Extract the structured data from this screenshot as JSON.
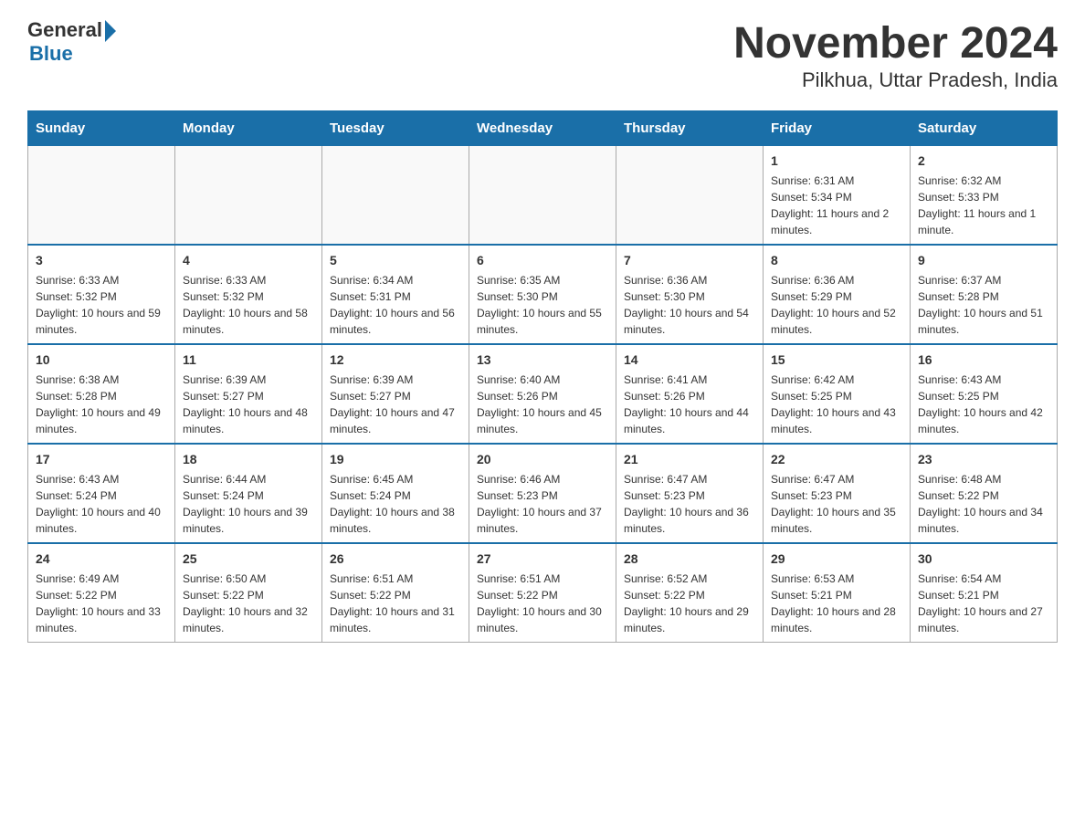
{
  "header": {
    "logo_general": "General",
    "logo_blue": "Blue",
    "title": "November 2024",
    "subtitle": "Pilkhua, Uttar Pradesh, India"
  },
  "days_of_week": [
    "Sunday",
    "Monday",
    "Tuesday",
    "Wednesday",
    "Thursday",
    "Friday",
    "Saturday"
  ],
  "weeks": [
    [
      {
        "day": "",
        "info": ""
      },
      {
        "day": "",
        "info": ""
      },
      {
        "day": "",
        "info": ""
      },
      {
        "day": "",
        "info": ""
      },
      {
        "day": "",
        "info": ""
      },
      {
        "day": "1",
        "info": "Sunrise: 6:31 AM\nSunset: 5:34 PM\nDaylight: 11 hours and 2 minutes."
      },
      {
        "day": "2",
        "info": "Sunrise: 6:32 AM\nSunset: 5:33 PM\nDaylight: 11 hours and 1 minute."
      }
    ],
    [
      {
        "day": "3",
        "info": "Sunrise: 6:33 AM\nSunset: 5:32 PM\nDaylight: 10 hours and 59 minutes."
      },
      {
        "day": "4",
        "info": "Sunrise: 6:33 AM\nSunset: 5:32 PM\nDaylight: 10 hours and 58 minutes."
      },
      {
        "day": "5",
        "info": "Sunrise: 6:34 AM\nSunset: 5:31 PM\nDaylight: 10 hours and 56 minutes."
      },
      {
        "day": "6",
        "info": "Sunrise: 6:35 AM\nSunset: 5:30 PM\nDaylight: 10 hours and 55 minutes."
      },
      {
        "day": "7",
        "info": "Sunrise: 6:36 AM\nSunset: 5:30 PM\nDaylight: 10 hours and 54 minutes."
      },
      {
        "day": "8",
        "info": "Sunrise: 6:36 AM\nSunset: 5:29 PM\nDaylight: 10 hours and 52 minutes."
      },
      {
        "day": "9",
        "info": "Sunrise: 6:37 AM\nSunset: 5:28 PM\nDaylight: 10 hours and 51 minutes."
      }
    ],
    [
      {
        "day": "10",
        "info": "Sunrise: 6:38 AM\nSunset: 5:28 PM\nDaylight: 10 hours and 49 minutes."
      },
      {
        "day": "11",
        "info": "Sunrise: 6:39 AM\nSunset: 5:27 PM\nDaylight: 10 hours and 48 minutes."
      },
      {
        "day": "12",
        "info": "Sunrise: 6:39 AM\nSunset: 5:27 PM\nDaylight: 10 hours and 47 minutes."
      },
      {
        "day": "13",
        "info": "Sunrise: 6:40 AM\nSunset: 5:26 PM\nDaylight: 10 hours and 45 minutes."
      },
      {
        "day": "14",
        "info": "Sunrise: 6:41 AM\nSunset: 5:26 PM\nDaylight: 10 hours and 44 minutes."
      },
      {
        "day": "15",
        "info": "Sunrise: 6:42 AM\nSunset: 5:25 PM\nDaylight: 10 hours and 43 minutes."
      },
      {
        "day": "16",
        "info": "Sunrise: 6:43 AM\nSunset: 5:25 PM\nDaylight: 10 hours and 42 minutes."
      }
    ],
    [
      {
        "day": "17",
        "info": "Sunrise: 6:43 AM\nSunset: 5:24 PM\nDaylight: 10 hours and 40 minutes."
      },
      {
        "day": "18",
        "info": "Sunrise: 6:44 AM\nSunset: 5:24 PM\nDaylight: 10 hours and 39 minutes."
      },
      {
        "day": "19",
        "info": "Sunrise: 6:45 AM\nSunset: 5:24 PM\nDaylight: 10 hours and 38 minutes."
      },
      {
        "day": "20",
        "info": "Sunrise: 6:46 AM\nSunset: 5:23 PM\nDaylight: 10 hours and 37 minutes."
      },
      {
        "day": "21",
        "info": "Sunrise: 6:47 AM\nSunset: 5:23 PM\nDaylight: 10 hours and 36 minutes."
      },
      {
        "day": "22",
        "info": "Sunrise: 6:47 AM\nSunset: 5:23 PM\nDaylight: 10 hours and 35 minutes."
      },
      {
        "day": "23",
        "info": "Sunrise: 6:48 AM\nSunset: 5:22 PM\nDaylight: 10 hours and 34 minutes."
      }
    ],
    [
      {
        "day": "24",
        "info": "Sunrise: 6:49 AM\nSunset: 5:22 PM\nDaylight: 10 hours and 33 minutes."
      },
      {
        "day": "25",
        "info": "Sunrise: 6:50 AM\nSunset: 5:22 PM\nDaylight: 10 hours and 32 minutes."
      },
      {
        "day": "26",
        "info": "Sunrise: 6:51 AM\nSunset: 5:22 PM\nDaylight: 10 hours and 31 minutes."
      },
      {
        "day": "27",
        "info": "Sunrise: 6:51 AM\nSunset: 5:22 PM\nDaylight: 10 hours and 30 minutes."
      },
      {
        "day": "28",
        "info": "Sunrise: 6:52 AM\nSunset: 5:22 PM\nDaylight: 10 hours and 29 minutes."
      },
      {
        "day": "29",
        "info": "Sunrise: 6:53 AM\nSunset: 5:21 PM\nDaylight: 10 hours and 28 minutes."
      },
      {
        "day": "30",
        "info": "Sunrise: 6:54 AM\nSunset: 5:21 PM\nDaylight: 10 hours and 27 minutes."
      }
    ]
  ]
}
